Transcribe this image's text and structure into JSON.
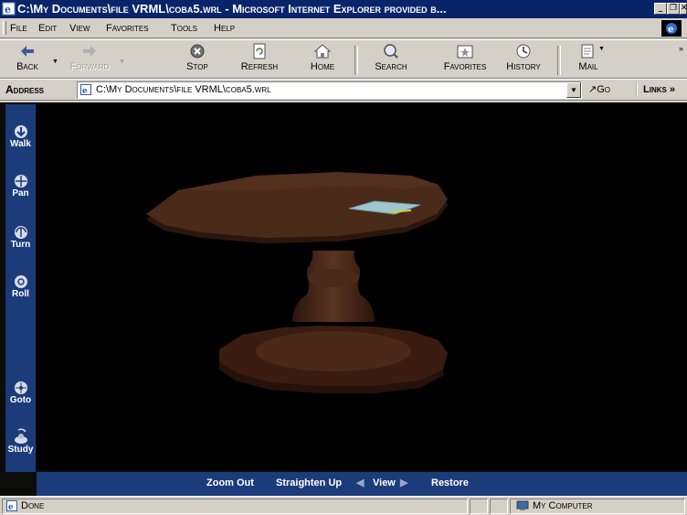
{
  "window": {
    "title": "C:\\My Documents\\file VRML\\coba5.wrl - Microsoft Internet Explorer provided b..."
  },
  "menu": {
    "items": [
      "File",
      "Edit",
      "View",
      "Favorites",
      "Tools",
      "Help"
    ],
    "accelerators": [
      "F",
      "E",
      "V",
      "a",
      "T",
      "H"
    ]
  },
  "toolbar": {
    "back_label": "Back",
    "forward_label": "Forward",
    "stop_label": "Stop",
    "refresh_label": "Refresh",
    "home_label": "Home",
    "search_label": "Search",
    "favorites_label": "Favorites",
    "history_label": "History",
    "mail_label": "Mail"
  },
  "address_bar": {
    "label": "Address",
    "value": "C:\\My Documents\\file VRML\\coba5.wrl",
    "go_label": "Go",
    "links_label": "Links"
  },
  "viewer": {
    "nav_buttons": [
      "Walk",
      "Pan",
      "Turn",
      "Roll",
      "Goto",
      "Study"
    ],
    "bottom_buttons": {
      "zoom_out": "Zoom Out",
      "straighten_up": "Straighten Up",
      "view": "View",
      "restore": "Restore"
    },
    "scene_object": "wooden-table",
    "colors": {
      "panel": "#1c3b7a",
      "background": "#000000",
      "wood": "#4a2a19"
    }
  },
  "status_bar": {
    "status": "Done",
    "zone": "My Computer"
  }
}
